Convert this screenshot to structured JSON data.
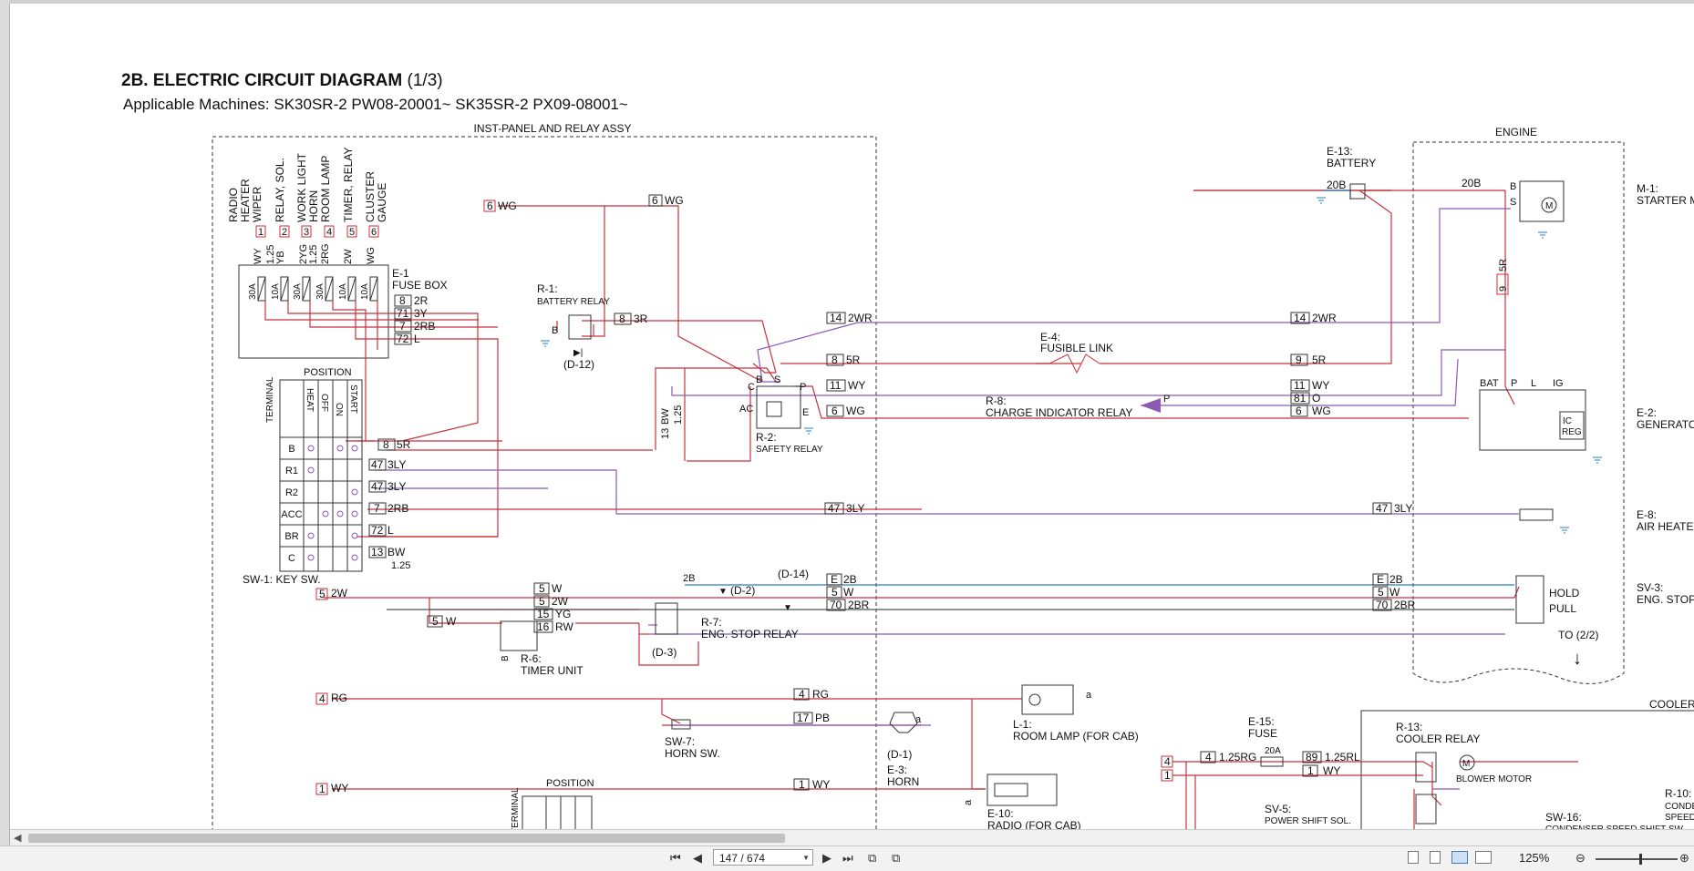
{
  "diagram": {
    "title_main": "2B. ELECTRIC CIRCUIT DIAGRAM",
    "title_part": "(1/3)",
    "applicable": "Applicable Machines: SK30SR-2  PW08-20001~    SK35SR-2  PX09-08001~",
    "box_inst": "INST-PANEL AND RELAY ASSY",
    "box_engine": "ENGINE",
    "to_next": "TO (2/2)",
    "fuse_functions": [
      "RADIO",
      "HEATER",
      "WIPER",
      "RELAY, SOL.",
      "WORK LIGHT",
      "HORN",
      "ROOM LAMP",
      "TIMER, RELAY",
      "CLUSTER",
      "GAUGE"
    ],
    "fuse_circuits": [
      "1",
      "2",
      "3",
      "4",
      "5",
      "6"
    ],
    "fuse_wires": [
      "WY",
      "1.25",
      "YB",
      "2YG",
      "1.25",
      "2RG",
      "2W",
      "WG"
    ],
    "fuse_ratings": [
      "30A",
      "10A",
      "30A",
      "30A",
      "10A",
      "10A"
    ],
    "key_sw_rows": [
      "B",
      "R1",
      "R2",
      "ACC",
      "BR",
      "C"
    ],
    "key_sw_positions": [
      "HEAT",
      "OFF",
      "ON",
      "START"
    ],
    "position_label": "POSITION",
    "terminal_label": "TERMINAL",
    "labels": {
      "e1_id": "E-1",
      "e1_name": "FUSE BOX",
      "r1_id": "R-1:",
      "r1_name": "BATTERY RELAY",
      "d12": "(D-12)",
      "r2_id": "R-2:",
      "r2_name": "SAFETY RELAY",
      "e13_id": "E-13:",
      "e13_name": "BATTERY",
      "e4_id": "E-4:",
      "e4_name": "FUSIBLE LINK",
      "r8_id": "R-8:",
      "r8_name": "CHARGE INDICATOR RELAY",
      "m1_id": "M-1:",
      "m1_name": "STARTER M",
      "e2_id": "E-2:",
      "e2_name": "GENERATOR",
      "e8_id": "E-8:",
      "e8_name": "AIR HEATER",
      "sv3_id": "SV-3:",
      "sv3_name": "ENG. STOP",
      "hold": "HOLD",
      "pull": "PULL",
      "sw1": "SW-1: KEY SW.",
      "d14": "(D-14)",
      "d2": "(D-2)",
      "r7_id": "R-7:",
      "r7_name": "ENG. STOP RELAY",
      "d3": "(D-3)",
      "r6_id": "R-6:",
      "r6_name": "TIMER UNIT",
      "sw7_id": "SW-7:",
      "sw7_name": "HORN SW.",
      "d1": "(D-1)",
      "e3_id": "E-3:",
      "e3_name": "HORN",
      "l1_id": "L-1:",
      "l1_name": "ROOM LAMP (FOR CAB)",
      "e10_id": "E-10:",
      "e10_name": "RADIO (FOR CAB)",
      "e15_id": "E-15:",
      "e15_name": "FUSE",
      "fuse20a": "20A",
      "r13_id": "R-13:",
      "r13_name": "COOLER RELAY",
      "blower": "BLOWER MOTOR",
      "sv5_id": "SV-5:",
      "sv5_name": "POWER SHIFT SOL.",
      "sw16_id": "SW-16:",
      "sw16_name": "CONDENSER SPEED SHIFT SW.",
      "r10_id": "R-10:",
      "r10_name": "CONDENS",
      "r10_name2": "SPEED SH",
      "cooler": "COOLER (",
      "bat": "BAT",
      "p": "P",
      "l": "L",
      "ig": "IG",
      "ic": "IC",
      "reg": "REG",
      "b": "B",
      "s": "S",
      "c": "C",
      "ac": "AC",
      "e": "E",
      "a": "a",
      "w125": "1.25",
      "bw125": "1.25",
      "bw": "BW",
      "w1": "W"
    },
    "wires": {
      "w6wg_a": "6",
      "w6wg_a_t": "WG",
      "w6wg_b": "6",
      "w6wg_b_t": "WG",
      "w8_2r": "8",
      "w8_2r_t": "2R",
      "w71_3y": "71",
      "w71_3y_t": "3Y",
      "w7_2rb": "7",
      "w7_2rb_t": "2RB",
      "w72_l": "72",
      "w72_l_t": "L",
      "w8_3r": "8",
      "w8_3r_t": "3R",
      "w14_2wr_a": "14",
      "w14_2wr_a_t": "2WR",
      "w14_2wr_b": "14",
      "w14_2wr_b_t": "2WR",
      "w8_5r_a": "8",
      "w8_5r_a_t": "5R",
      "w9_5r_a": "9",
      "w9_5r_a_t": "5R",
      "w9_5r_b": "9",
      "w9_5r_b_t": "5R",
      "w11_wy_a": "11",
      "w11_wy_a_t": "WY",
      "w11_wy_b": "11",
      "w11_wy_b_t": "WY",
      "w81_o": "81",
      "w81_o_t": "O",
      "w6_wg_c": "6",
      "w6_wg_c_t": "WG",
      "w6_wg_d": "6",
      "w6_wg_d_t": "WG",
      "w8_5r_b": "8",
      "w8_5r_b_t": "5R",
      "w47_3ly_a": "47",
      "w47_3ly_a_t": "3LY",
      "w47_3ly_b": "47",
      "w47_3ly_b_t": "3LY",
      "w47_3ly_c": "47",
      "w47_3ly_c_t": "3LY",
      "w47_3ly_d": "47",
      "w47_3ly_d_t": "3LY",
      "w7_2rb_b": "7",
      "w7_2rb_b_t": "2RB",
      "w72_l_b": "72",
      "w72_l_b_t": "L",
      "w13_bw": "13",
      "w13_bw_t": "BW",
      "w13_v": "13",
      "we_2b_a": "E",
      "we_2b_a_t": "2B",
      "we_2b_b": "E",
      "we_2b_b_t": "2B",
      "w5_w_a": "5",
      "w5_w_a_t": "2W",
      "w5_w_b": "5",
      "w5_w_b_t": "W",
      "w5_w_c": "5",
      "w5_w_c_t": "W",
      "w5_w_d": "5",
      "w5_w_d_t": "W",
      "w5_2w": "5",
      "w5_2w_t": "2W",
      "w5_w_e": "5",
      "w5_w_e_t": "W",
      "w15_yg": "15",
      "w15_yg_t": "YG",
      "w16_rw": "16",
      "w16_rw_t": "RW",
      "w70_2br_a": "70",
      "w70_2br_a_t": "2BR",
      "w70_2br_b": "70",
      "w70_2br_b_t": "2BR",
      "w2b": "2B",
      "w20b_a": "20B",
      "w20b_b": "20B",
      "w4_rg_a": "4",
      "w4_rg_a_t": "RG",
      "w4_rg_b": "4",
      "w4_rg_b_t": "RG",
      "w17_pb": "17",
      "w17_pb_t": "PB",
      "w1_wy_a": "1",
      "w1_wy_a_t": "WY",
      "w1_wy_b": "1",
      "w1_wy_b_t": "WY",
      "w4_cool": "4",
      "w4_125rg": "4",
      "w4_125rg_t": "1.25RG",
      "w1_cool": "1",
      "w89": "89",
      "w89_t": "1.25RL",
      "w1_wy_c": "1",
      "w1_wy_c_t": "WY"
    }
  },
  "viewer": {
    "page_indicator": "147 / 674",
    "zoom": "125%"
  },
  "colors": {
    "red_wire": "#c8323c",
    "purple_wire": "#8a5ab5",
    "blue_wire": "#2a7fbf",
    "gray_wire": "#555555",
    "background": "#ffffff"
  }
}
